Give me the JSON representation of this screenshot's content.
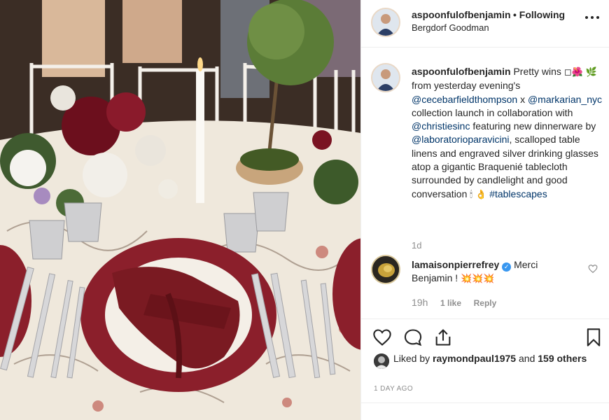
{
  "post": {
    "username": "aspoonfulofbenjamin",
    "follow_status": "• Following",
    "location": "Bergdorf Goodman"
  },
  "caption": {
    "username": "aspoonfulofbenjamin",
    "text_intro": "Pretty wins",
    "emoji_1": "◻🌺",
    "emoji_2": "🌿",
    "text_after_emoji": "from yesterday evening's",
    "mention_1": "@cecebarfieldthompson",
    "text_x": "x",
    "mention_2": "@markarian_nyc",
    "text_collection": "collection launch in collaboration with",
    "mention_3": "@christiesinc",
    "text_featuring": "featuring new dinnerware by",
    "mention_4": "@laboratorioparavicini",
    "text_rest": ", scalloped table linens and engraved silver drinking glasses atop a gigantic Braquenié tablecloth surrounded by candlelight and good conversation",
    "emoji_3": "🕯 👌",
    "hashtag": "#tablescapes",
    "time": "1d"
  },
  "comment": {
    "username": "lamaisonpierrefrey",
    "verified_icon": "✓",
    "text": "Merci Benjamin !",
    "emoji": "💥💥💥",
    "time": "19h",
    "likes": "1 like",
    "reply": "Reply"
  },
  "actions": {
    "icons": [
      "heart-icon",
      "comment-icon",
      "share-icon",
      "bookmark-icon"
    ]
  },
  "likes": {
    "prefix": "Liked by",
    "user": "raymondpaul1975",
    "conjunction": "and",
    "others": "159 others"
  },
  "timestamp": "1 DAY AGO",
  "colors": {
    "link": "#003569",
    "meta": "#8e8e8e",
    "verified": "#3897f0",
    "napkin": "#7a1a22"
  }
}
